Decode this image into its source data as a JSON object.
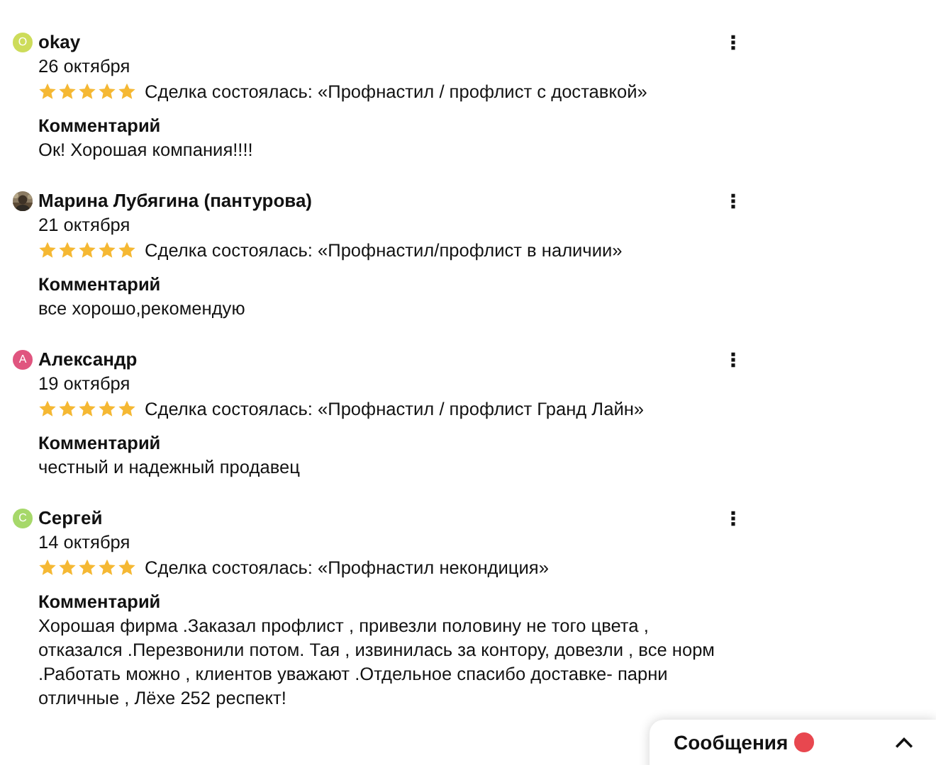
{
  "reviews": [
    {
      "avatar": {
        "kind": "letter",
        "letter": "O",
        "color": "#cddc5a"
      },
      "name": "okay",
      "date": "26 октября",
      "stars": 5,
      "deal": "Сделка состоялась: «Профнастил / профлист с доставкой»",
      "comment_label": "Комментарий",
      "comment": "Ок! Хорошая компания!!!!"
    },
    {
      "name": "Марина Лубягина (пантурова)",
      "date": "21 октября",
      "stars": 5,
      "deal": "Сделка состоялась: «Профнастил/профлист в наличии»",
      "comment_label": "Комментарий",
      "comment": "все хорошо,рекомендую"
    },
    {
      "avatar": {
        "kind": "letter",
        "letter": "А",
        "color": "#e0557f"
      },
      "name": "Александр",
      "date": "19 октября",
      "stars": 5,
      "deal": "Сделка состоялась: «Профнастил / профлист Гранд Лайн»",
      "comment_label": "Комментарий",
      "comment": "честный и надежный продавец"
    },
    {
      "avatar": {
        "kind": "letter",
        "letter": "С",
        "color": "#a6d86a"
      },
      "name": "Сергей",
      "date": "14 октября",
      "stars": 5,
      "deal": "Сделка состоялась: «Профнастил некондиция»",
      "comment_label": "Комментарий",
      "comment": "Хорошая фирма .Заказал профлист , привезли половину не того цвета , отказался .Перезвонили потом. Тая , извинилась за контору, довезли , все норм .Работать можно , клиентов уважают .Отдельное спасибо доставке- парни отличные , Лёхе 252 респект!"
    }
  ],
  "messages_bar": {
    "label": "Сообщения"
  }
}
